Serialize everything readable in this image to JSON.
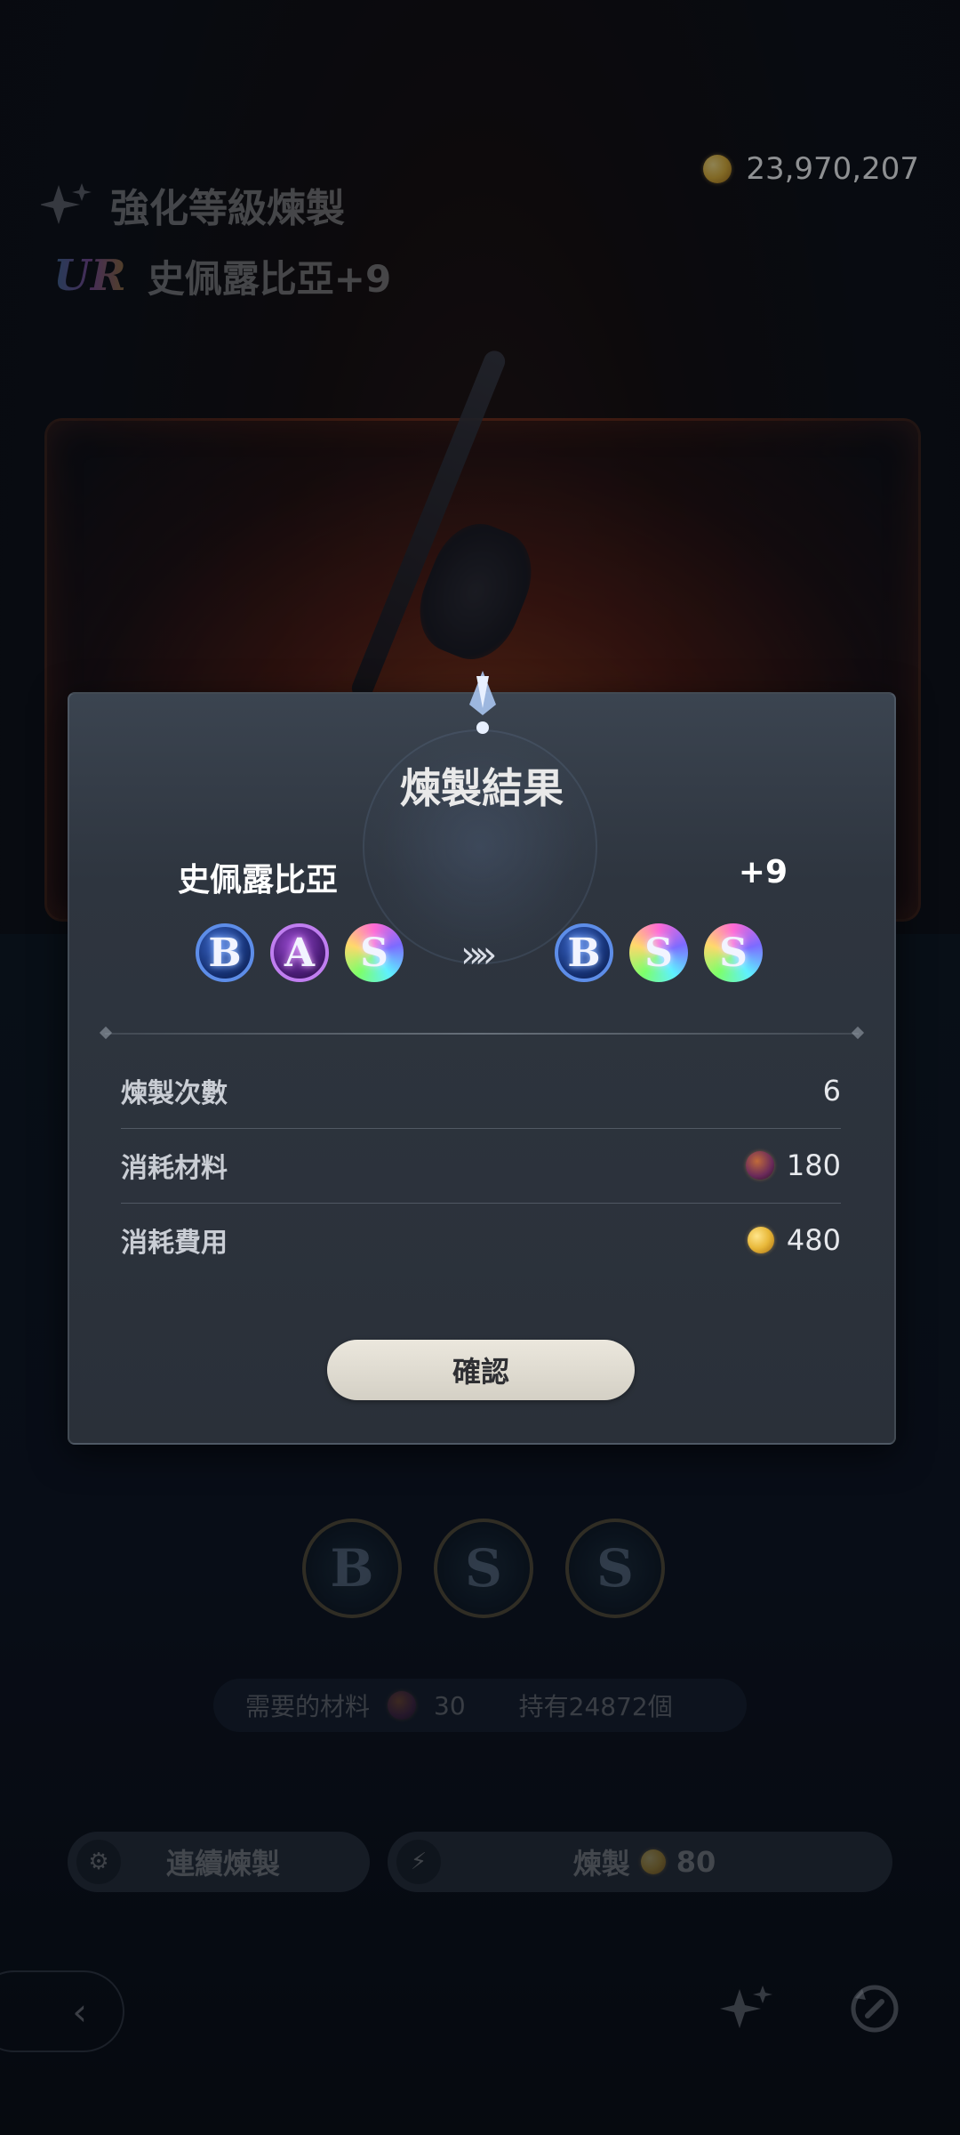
{
  "header": {
    "title": "強化等級煉製",
    "rarity": "UR",
    "item_name": "史佩露比亞+9",
    "currency_amount": "23,970,207"
  },
  "background_slots": [
    "B",
    "S",
    "S"
  ],
  "materials_bar": {
    "label": "需要的材料",
    "required": "30",
    "owned": "持有24872個"
  },
  "actions": {
    "continuous_label": "連續煉製",
    "refine_label": "煉製",
    "refine_cost": "80"
  },
  "dialog": {
    "title": "煉製結果",
    "item_name": "史佩露比亞",
    "item_level": "+9",
    "before_grades": [
      "B",
      "A",
      "S"
    ],
    "after_grades": [
      "B",
      "S",
      "S"
    ],
    "arrow": "»»",
    "rows": [
      {
        "label": "煉製次數",
        "value": "6"
      },
      {
        "label": "消耗材料",
        "value": "180",
        "icon": "material-icon"
      },
      {
        "label": "消耗費用",
        "value": "480",
        "icon": "coin-icon"
      }
    ],
    "confirm_label": "確認"
  },
  "colors": {
    "grade_b": "#5d8de8",
    "grade_a": "#c07ef0",
    "confirm_bg": "#ebe7dd",
    "modal_bg": "#2e353f"
  }
}
